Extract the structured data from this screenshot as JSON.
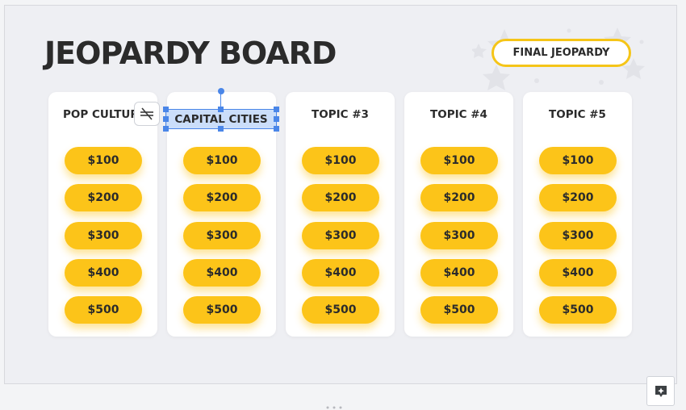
{
  "slide": {
    "title": "JEOPARDY BOARD",
    "final_button": "FINAL JEOPARDY"
  },
  "columns": [
    {
      "header": "POP CULTURE",
      "values": [
        "$100",
        "$200",
        "$300",
        "$400",
        "$500"
      ]
    },
    {
      "header": "CAPITAL CITIES",
      "values": [
        "$100",
        "$200",
        "$300",
        "$400",
        "$500"
      ]
    },
    {
      "header": "TOPIC #3",
      "values": [
        "$100",
        "$200",
        "$300",
        "$400",
        "$500"
      ]
    },
    {
      "header": "TOPIC #4",
      "values": [
        "$100",
        "$200",
        "$300",
        "$400",
        "$500"
      ]
    },
    {
      "header": "TOPIC #5",
      "values": [
        "$100",
        "$200",
        "$300",
        "$400",
        "$500"
      ]
    }
  ],
  "colors": {
    "accent": "#fcc419",
    "selection": "#4a86e8",
    "text": "#2b2b2b"
  },
  "icons": {
    "format_toggle": "unlink-icon",
    "explore": "explore-sparkle-icon"
  }
}
